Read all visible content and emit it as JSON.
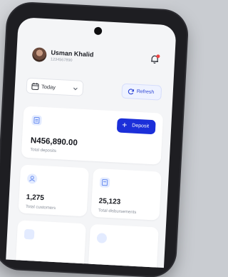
{
  "user": {
    "name": "Usman Khalid",
    "id": "1234567890"
  },
  "filters": {
    "date_label": "Today",
    "refresh_label": "Refresh"
  },
  "summary": {
    "amount": "N456,890.00",
    "label": "Total deposits",
    "deposit_label": "Deposit"
  },
  "stats": [
    {
      "value": "1,275",
      "label": "Total customers"
    },
    {
      "value": "25,123",
      "label": "Total disbursements"
    }
  ],
  "colors": {
    "primary": "#1b2fd9",
    "accent_soft": "#e3ebff",
    "notification": "#ef4444"
  },
  "icons": {
    "bell": "bell-icon",
    "calendar": "calendar-icon",
    "chevron": "chevron-down-icon",
    "refresh": "refresh-icon",
    "plus": "plus-icon"
  }
}
